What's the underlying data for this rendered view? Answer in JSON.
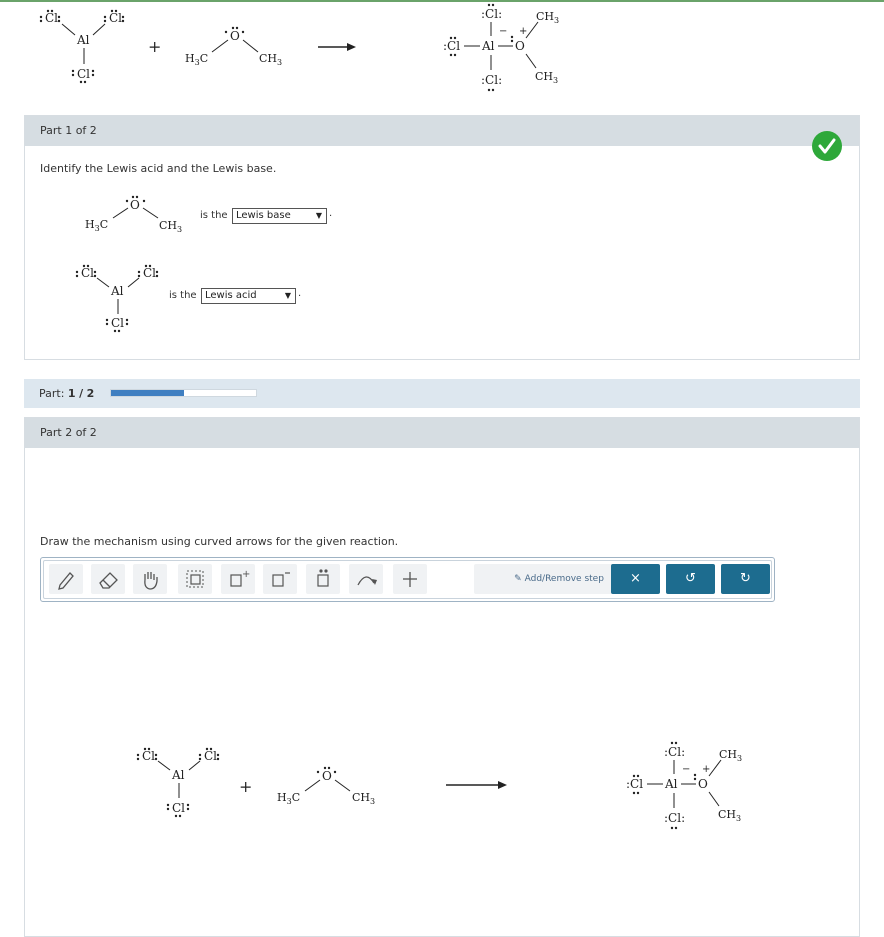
{
  "part1": {
    "header": "Part 1 of 2",
    "instruction": "Identify the Lewis acid and the Lewis base.",
    "row1": {
      "phrase": "is the",
      "selected": "Lewis base"
    },
    "row2": {
      "phrase": "is the",
      "selected": "Lewis acid"
    },
    "status": "correct"
  },
  "progress": {
    "label": "Part:",
    "current": "1",
    "sep": "/",
    "total": "2",
    "fraction": 0.5
  },
  "part2": {
    "header": "Part 2 of 2",
    "instruction": "Draw the mechanism using curved arrows for the given reaction."
  },
  "toolbar": {
    "tools": [
      "pencil-icon",
      "eraser-icon",
      "hand-icon",
      "select-box-icon",
      "add-positive-charge-icon",
      "add-negative-charge-icon",
      "lone-pair-icon",
      "curved-arrow-icon",
      "plus-icon"
    ],
    "add_remove_label": "Add/Remove step",
    "clear_label": "×",
    "undo_label": "↺",
    "redo_label": "↻",
    "clear_color": "#1d6c8f"
  },
  "chem": {
    "cl": "Cl",
    "al": "Al",
    "o": "O",
    "ch3": "CH",
    "h3c": "H",
    "c": "C",
    "sub3": "3",
    "plus": "+",
    "minus": "−",
    "colon": ":"
  }
}
